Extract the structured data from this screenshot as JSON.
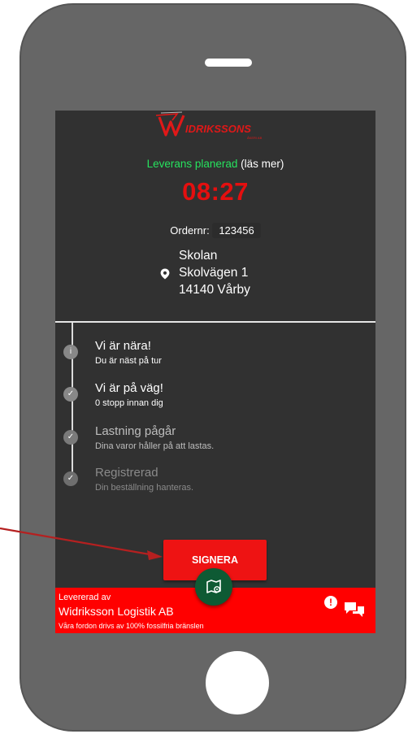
{
  "colors": {
    "phone_body": "#666666",
    "screen_bg": "#313131",
    "accent_red": "#ff0000",
    "status_green": "#26e35e",
    "fab_green": "#0e5a34",
    "annotation_arrow": "#b52020"
  },
  "brand": {
    "logo_text": "IDRIKSSONS",
    "logo_small": "ÅKERI AB"
  },
  "status": {
    "label": "Leverans planerad",
    "more": "(läs mer)"
  },
  "time": "08:27",
  "order": {
    "label": "Ordernr:",
    "number": "123456"
  },
  "address": {
    "icon": "location-pin-icon",
    "line1": "Skolan",
    "line2": "Skolvägen 1",
    "line3": "14140 Vårby"
  },
  "timeline": [
    {
      "title": "Vi är nära!",
      "subtitle": "Du är näst på tur",
      "icon": "info-icon",
      "glyph": "i",
      "title_color": "#ffffff",
      "sub_color": "#ffffff",
      "dot_color": "#888888"
    },
    {
      "title": "Vi är på väg!",
      "subtitle": "0 stopp innan dig",
      "icon": "check-icon",
      "glyph": "✓",
      "title_color": "#ffffff",
      "sub_color": "#ffffff",
      "dot_color": "#888888"
    },
    {
      "title": "Lastning pågår",
      "subtitle": "Dina varor håller på att lastas.",
      "icon": "check-icon",
      "glyph": "✓",
      "title_color": "#bdbdbd",
      "sub_color": "#bdbdbd",
      "dot_color": "#7a7a7a"
    },
    {
      "title": "Registrerad",
      "subtitle": "Din beställning hanteras.",
      "icon": "check-icon",
      "glyph": "✓",
      "title_color": "#8a8a8a",
      "sub_color": "#8a8a8a",
      "dot_color": "#6e6e6e"
    }
  ],
  "sign_button": {
    "label": "SIGNERA"
  },
  "map_button": {
    "icon": "map-location-icon"
  },
  "footer": {
    "delivered_by_label": "Levererad av",
    "company": "Widriksson Logistik AB",
    "eco_text": "Våra fordon drivs av 100% fossilfria bränslen",
    "alert_icon": "alert-icon",
    "alert_glyph": "!",
    "chat_icon": "chat-icon"
  }
}
